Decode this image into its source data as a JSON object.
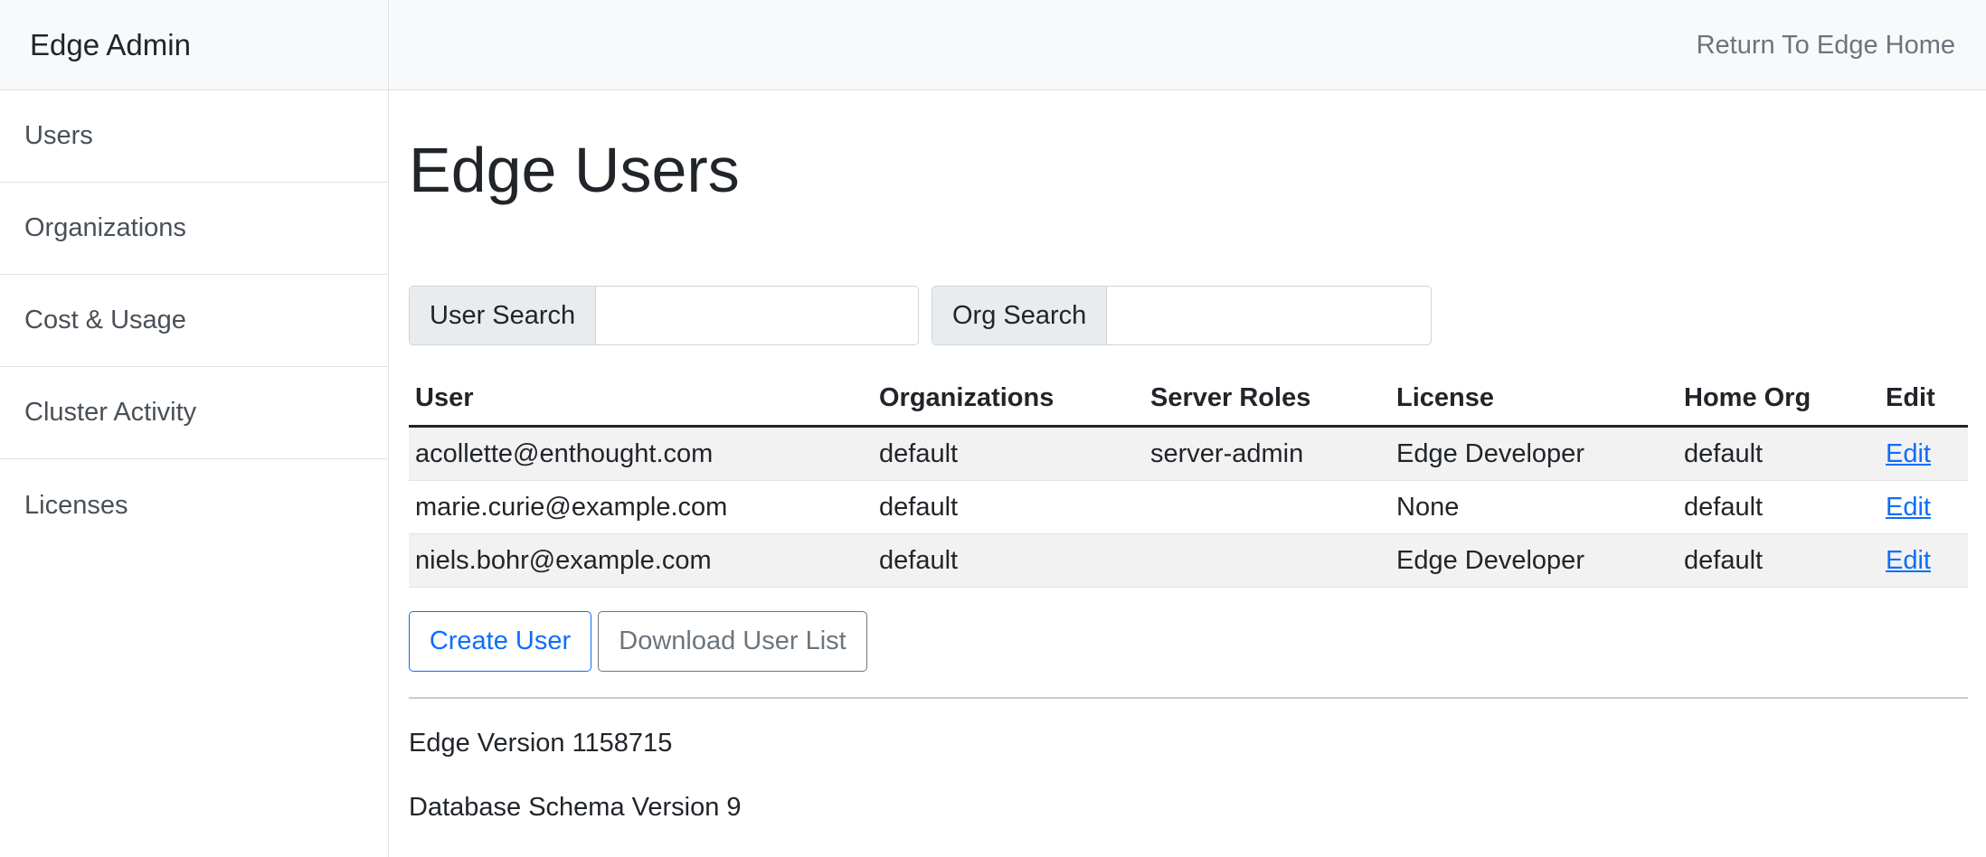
{
  "sidebar": {
    "title": "Edge Admin",
    "items": [
      {
        "label": "Users"
      },
      {
        "label": "Organizations"
      },
      {
        "label": "Cost & Usage"
      },
      {
        "label": "Cluster Activity"
      },
      {
        "label": "Licenses"
      }
    ]
  },
  "topbar": {
    "return_link": "Return To Edge Home"
  },
  "main": {
    "title": "Edge Users",
    "user_search": {
      "label": "User Search",
      "value": "",
      "placeholder": ""
    },
    "org_search": {
      "label": "Org Search",
      "value": "",
      "placeholder": ""
    },
    "table": {
      "headers": [
        "User",
        "Organizations",
        "Server Roles",
        "License",
        "Home Org",
        "Edit"
      ],
      "rows": [
        {
          "user": "acollette@enthought.com",
          "organizations": "default",
          "server_roles": "server-admin",
          "license": "Edge Developer",
          "home_org": "default",
          "edit": "Edit"
        },
        {
          "user": "marie.curie@example.com",
          "organizations": "default",
          "server_roles": "",
          "license": "None",
          "home_org": "default",
          "edit": "Edit"
        },
        {
          "user": "niels.bohr@example.com",
          "organizations": "default",
          "server_roles": "",
          "license": "Edge Developer",
          "home_org": "default",
          "edit": "Edit"
        }
      ]
    },
    "buttons": {
      "create_user": "Create User",
      "download_user_list": "Download User List"
    },
    "footer": {
      "edge_version": "Edge Version 1158715",
      "schema_version": "Database Schema Version 9"
    }
  },
  "colors": {
    "primary": "#0d6efd",
    "secondary": "#6c757d",
    "header_bg": "#f8f9fa",
    "stripe_bg": "#f2f2f2"
  }
}
